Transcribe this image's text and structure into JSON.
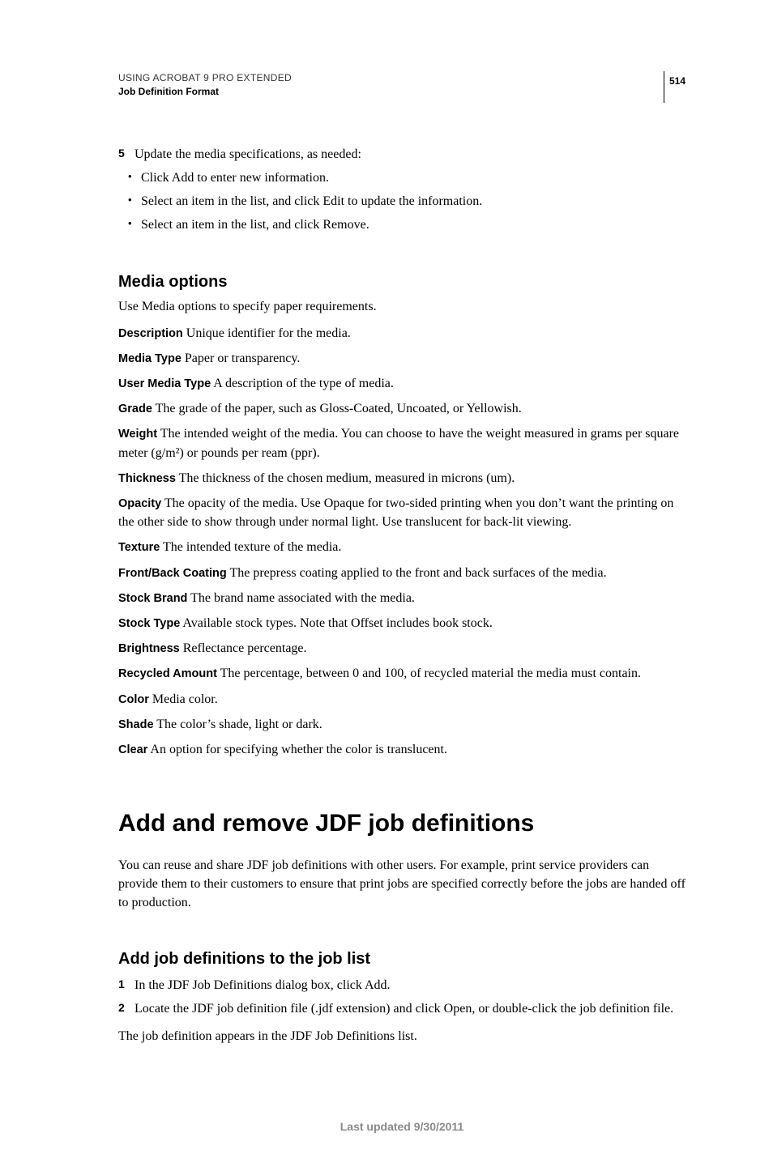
{
  "header": {
    "product": "USING ACROBAT 9 PRO EXTENDED",
    "section": "Job Definition Format",
    "page_number": "514"
  },
  "step5": {
    "num": "5",
    "text": "Update the media specifications, as needed:",
    "bullets": [
      "Click Add to enter new information.",
      "Select an item in the list, and click Edit to update the information.",
      "Select an item in the list, and click Remove."
    ]
  },
  "media_options": {
    "heading": "Media options",
    "intro": "Use Media options to specify paper requirements.",
    "defs": [
      {
        "term": "Description",
        "body": "Unique identifier for the media."
      },
      {
        "term": "Media Type",
        "body": "Paper or transparency."
      },
      {
        "term": "User Media Type",
        "body": "A description of the type of media."
      },
      {
        "term": "Grade",
        "body": "The grade of the paper, such as Gloss-Coated, Uncoated, or Yellowish."
      },
      {
        "term": "Weight",
        "body": "The intended weight of the media. You can choose to have the weight measured in grams per square meter (g/m²) or pounds per ream (ppr)."
      },
      {
        "term": "Thickness",
        "body": "The thickness of the chosen medium, measured in microns (um)."
      },
      {
        "term": "Opacity",
        "body": "The opacity of the media. Use Opaque for two-sided printing when you don’t want the printing on the other side to show through under normal light. Use translucent for back-lit viewing."
      },
      {
        "term": "Texture",
        "body": "The intended texture of the media."
      },
      {
        "term": "Front/Back Coating",
        "body": "The prepress coating applied to the front and back surfaces of the media."
      },
      {
        "term": "Stock Brand",
        "body": "The brand name associated with the media."
      },
      {
        "term": "Stock Type",
        "body": "Available stock types. Note that Offset includes book stock."
      },
      {
        "term": "Brightness",
        "body": "Reflectance percentage."
      },
      {
        "term": "Recycled Amount",
        "body": "The percentage, between 0 and 100, of recycled material the media must contain."
      },
      {
        "term": "Color",
        "body": "Media color."
      },
      {
        "term": "Shade",
        "body": "The color’s shade, light or dark."
      },
      {
        "term": "Clear",
        "body": "An option for specifying whether the color is translucent."
      }
    ]
  },
  "add_remove": {
    "heading": "Add and remove JDF job definitions",
    "intro": "You can reuse and share JDF job definitions with other users. For example, print service providers can provide them to their customers to ensure that print jobs are specified correctly before the jobs are handed off to production."
  },
  "add_job": {
    "heading": "Add job definitions to the job list",
    "steps": [
      {
        "num": "1",
        "text": "In the JDF Job Definitions dialog box, click Add."
      },
      {
        "num": "2",
        "text": "Locate the JDF job definition file (.jdf extension) and click Open, or double-click the job definition file."
      }
    ],
    "after": "The job definition appears in the JDF Job Definitions list."
  },
  "footer": "Last updated 9/30/2011"
}
